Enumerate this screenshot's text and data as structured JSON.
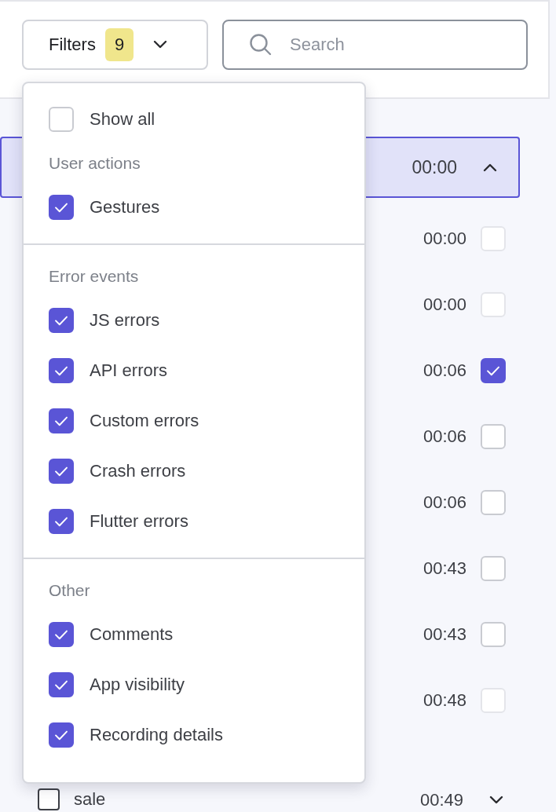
{
  "toolbar": {
    "filter_button": {
      "label": "Filters",
      "count": "9",
      "expanded": true
    },
    "search": {
      "placeholder": "Search"
    }
  },
  "events": [
    {
      "kind": "header",
      "time": "00:00",
      "selected": true,
      "expanded": true
    },
    {
      "kind": "event",
      "time": "00:00",
      "checked": false,
      "disabled": true
    },
    {
      "kind": "event",
      "time": "00:00",
      "checked": false,
      "disabled": true
    },
    {
      "kind": "event",
      "time": "00:06",
      "checked": true,
      "disabled": false
    },
    {
      "kind": "event",
      "time": "00:06",
      "checked": false,
      "disabled": false
    },
    {
      "kind": "event",
      "time": "00:06",
      "checked": false,
      "disabled": false
    },
    {
      "kind": "event",
      "time": "00:43",
      "checked": false,
      "disabled": false
    },
    {
      "kind": "event",
      "time": "00:43",
      "checked": false,
      "disabled": false
    },
    {
      "kind": "event",
      "time": "00:48",
      "checked": false,
      "disabled": true
    },
    {
      "kind": "group",
      "label": "sale",
      "time": "00:49",
      "checked": false,
      "expanded": false
    }
  ],
  "filter_menu": {
    "groups": [
      {
        "entries": [
          {
            "kind": "option",
            "label": "Show all",
            "checked": false
          },
          {
            "kind": "heading",
            "label": "User actions"
          },
          {
            "kind": "option",
            "label": "Gestures",
            "checked": true
          }
        ]
      },
      {
        "entries": [
          {
            "kind": "heading",
            "label": "Error events"
          },
          {
            "kind": "option",
            "label": "JS errors",
            "checked": true
          },
          {
            "kind": "option",
            "label": "API errors",
            "checked": true
          },
          {
            "kind": "option",
            "label": "Custom errors",
            "checked": true
          },
          {
            "kind": "option",
            "label": "Crash errors",
            "checked": true
          },
          {
            "kind": "option",
            "label": "Flutter errors",
            "checked": true
          }
        ]
      },
      {
        "entries": [
          {
            "kind": "heading",
            "label": "Other"
          },
          {
            "kind": "option",
            "label": "Comments",
            "checked": true
          },
          {
            "kind": "option",
            "label": "App visibility",
            "checked": true
          },
          {
            "kind": "option",
            "label": "Recording details",
            "checked": true
          }
        ]
      }
    ]
  }
}
